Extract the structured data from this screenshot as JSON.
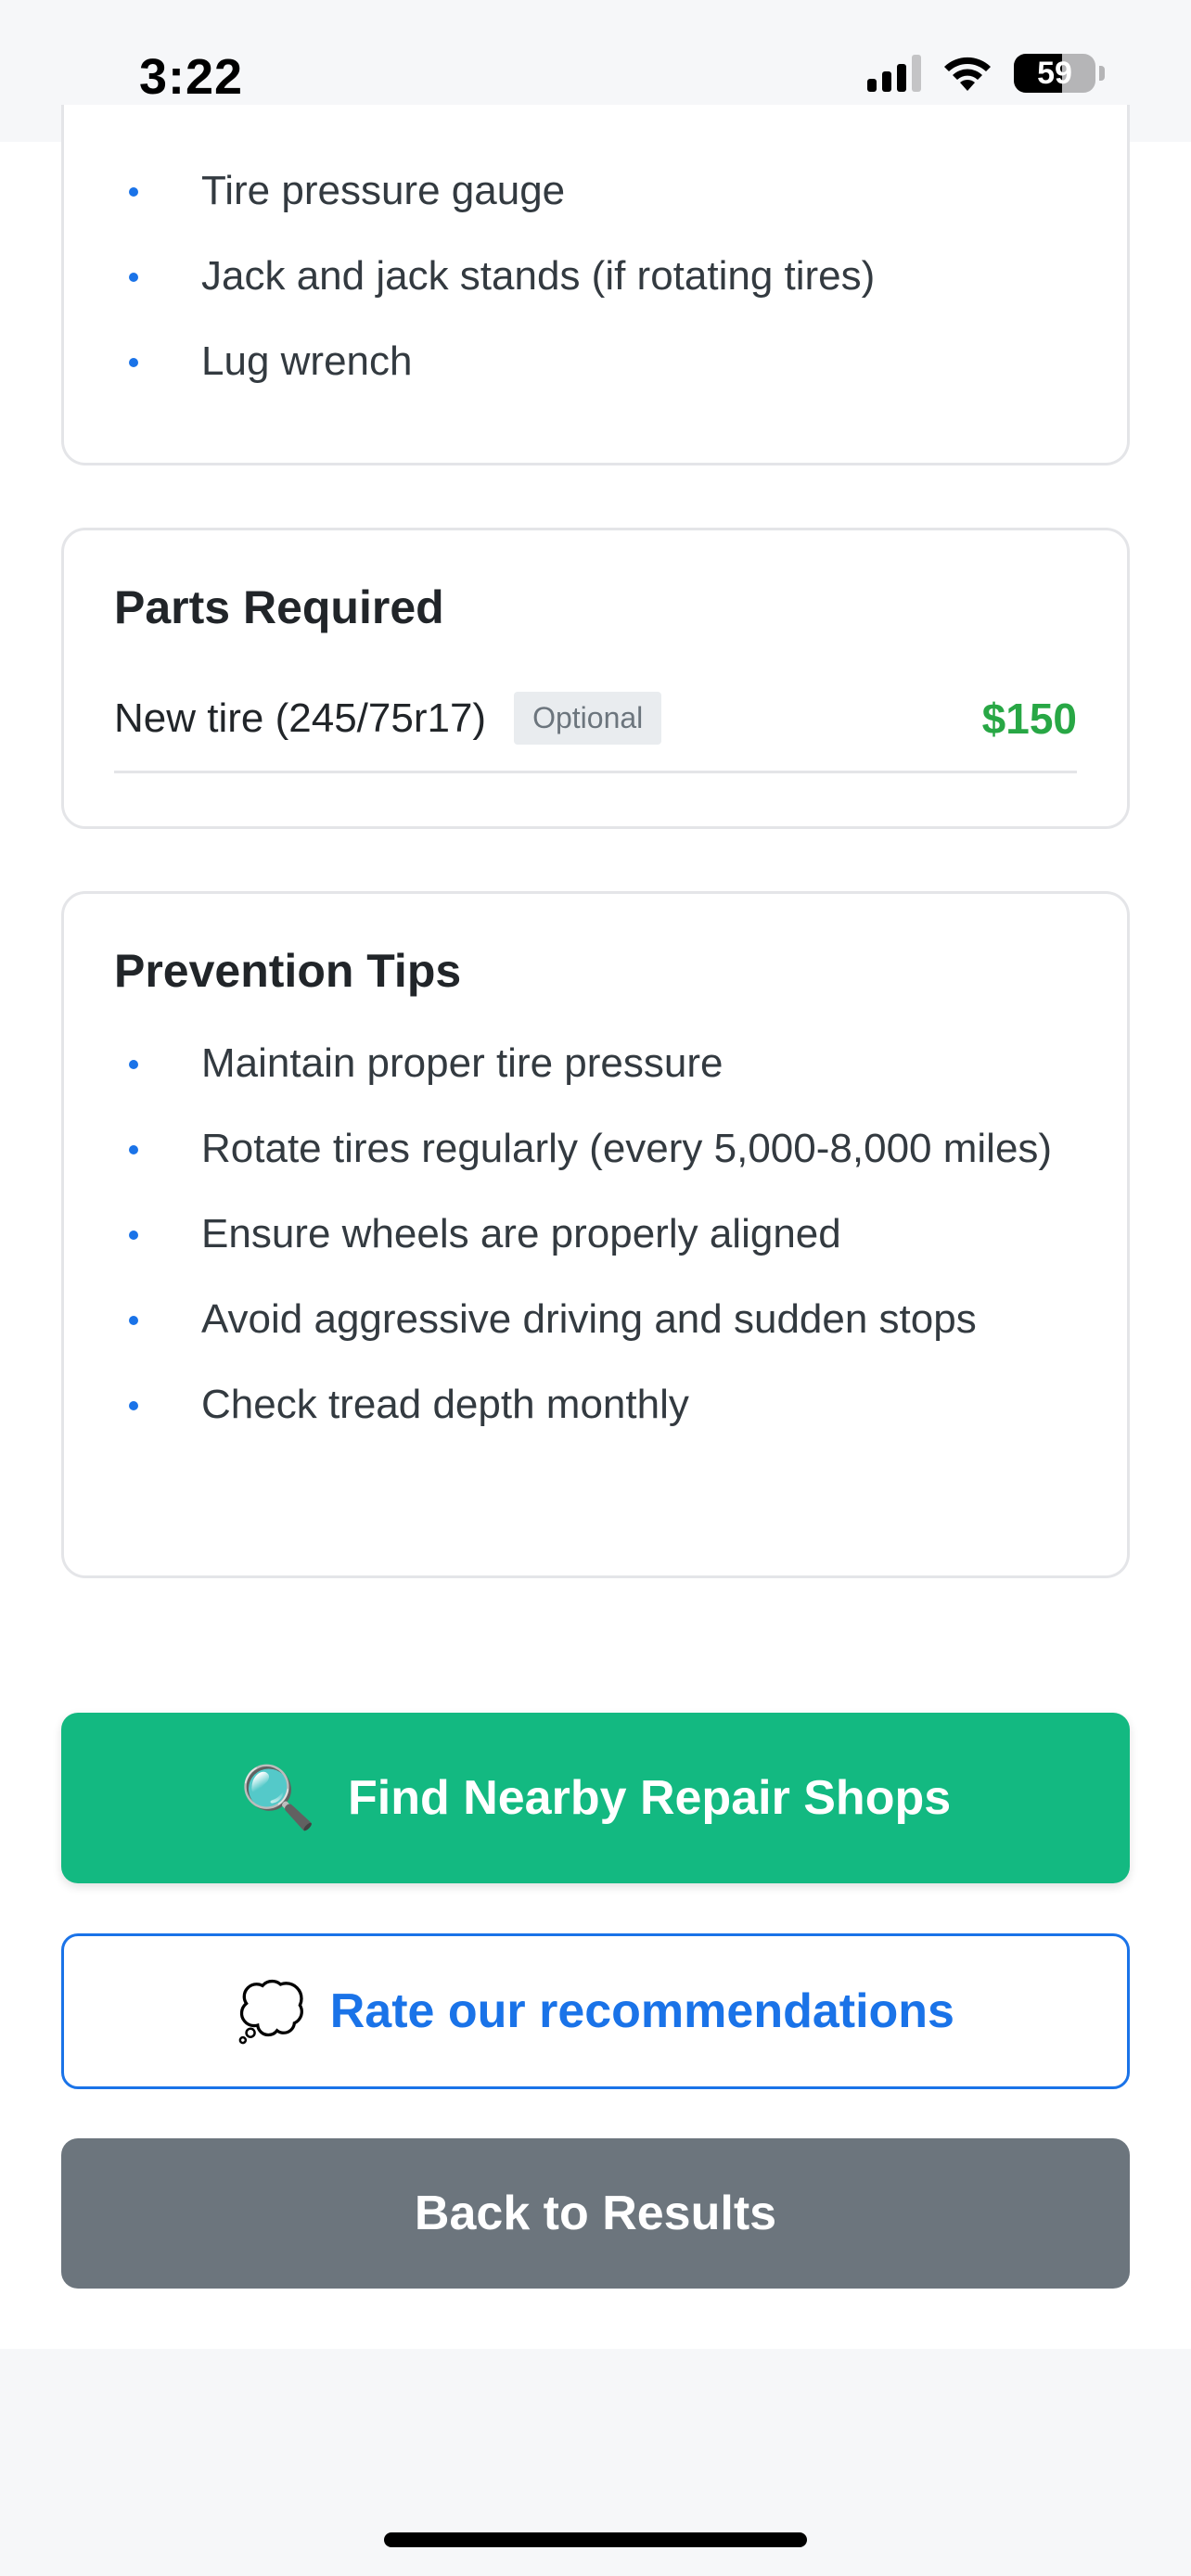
{
  "status_bar": {
    "time": "3:22",
    "battery_percent": "59",
    "battery_level": 0.59
  },
  "tools_card": {
    "items": [
      "Tire pressure gauge",
      "Jack and jack stands (if rotating tires)",
      "Lug wrench"
    ]
  },
  "parts_card": {
    "title": "Parts Required",
    "parts": [
      {
        "name": "New tire (245/75r17)",
        "badge": "Optional",
        "price": "$150"
      }
    ]
  },
  "tips_card": {
    "title": "Prevention Tips",
    "items": [
      "Maintain proper tire pressure",
      "Rotate tires regularly (every 5,000-8,000 miles)",
      "Ensure wheels are properly aligned",
      "Avoid aggressive driving and sudden stops",
      "Check tread depth monthly"
    ]
  },
  "actions": {
    "find_shops": {
      "icon": "🔍",
      "icon_name": "magnifying-glass-icon",
      "label": "Find Nearby Repair Shops"
    },
    "rate": {
      "icon": "💭",
      "icon_name": "thought-bubble-icon",
      "label": "Rate our recommendations"
    },
    "back": {
      "label": "Back to Results"
    }
  },
  "colors": {
    "accent_blue": "#1a73e8",
    "primary_green": "#13b981",
    "price_green": "#28a745",
    "secondary_gray": "#6c757d"
  }
}
